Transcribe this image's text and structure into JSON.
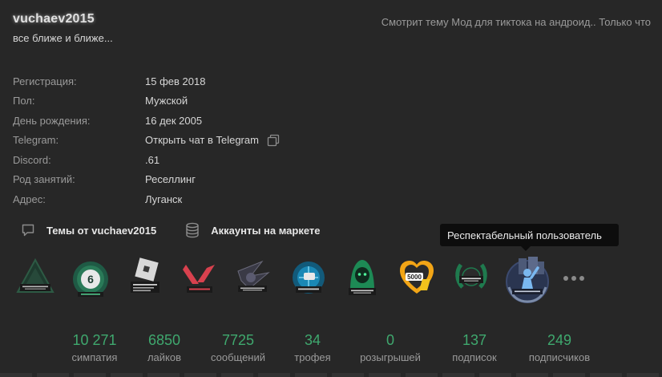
{
  "profile": {
    "username": "vuchaev2015",
    "status": "все ближе и ближе...",
    "activity": "Смотрит тему Мод для тиктока на андроид.. Только что"
  },
  "info": [
    {
      "key": "Регистрация:",
      "value": "15 фев 2018"
    },
    {
      "key": "Пол:",
      "value": "Мужской"
    },
    {
      "key": "День рождения:",
      "value": "16 дек 2005"
    },
    {
      "key": "Telegram:",
      "value": "Открыть чат в Telegram"
    },
    {
      "key": "Discord:",
      "value": ".61"
    },
    {
      "key": "Род занятий:",
      "value": "Реселлинг"
    },
    {
      "key": "Адрес:",
      "value": "Луганск"
    }
  ],
  "links": {
    "threads": "Темы от vuchaev2015",
    "market": "Аккаунты на маркете"
  },
  "tooltip": "Респектабельный пользователь",
  "trophy_icons": [
    "triangle-trophy-icon",
    "rainbow-six-trophy-icon",
    "roblox-trophy-icon",
    "valorant-trophy-icon",
    "wings-trophy-icon",
    "globe-trophy-icon",
    "green-hood-trophy-icon",
    "heart-5000-trophy-icon",
    "laurel-5000-trophy-icon",
    "respectable-user-trophy-icon"
  ],
  "stats": [
    {
      "num": "10 271",
      "label": "симпатия"
    },
    {
      "num": "6850",
      "label": "лайков"
    },
    {
      "num": "7725",
      "label": "сообщений"
    },
    {
      "num": "34",
      "label": "трофея"
    },
    {
      "num": "0",
      "label": "розыгрышей"
    },
    {
      "num": "137",
      "label": "подписок"
    },
    {
      "num": "249",
      "label": "подписчиков"
    }
  ],
  "colors": {
    "background": "#272727",
    "accent": "#3fa86e",
    "muted": "#9a9a9a"
  }
}
